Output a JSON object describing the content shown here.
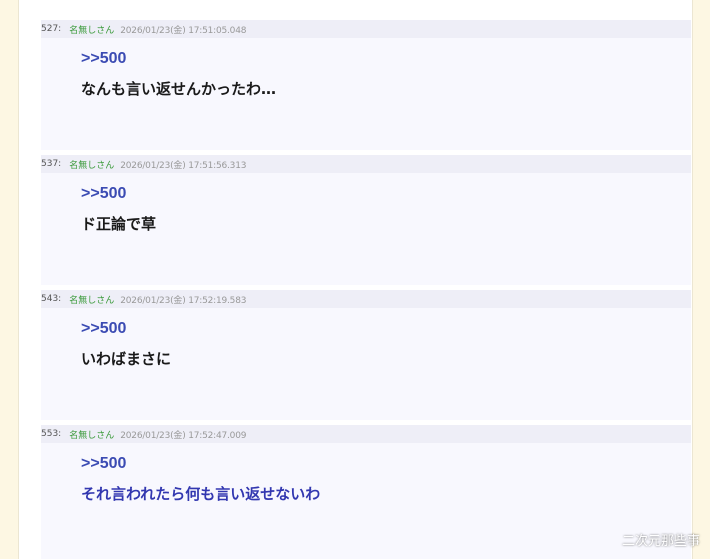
{
  "posts": [
    {
      "num": "527:",
      "name": "名無しさん",
      "date": "2026/01/23(金) 17:51:05.048",
      "anchor": ">>500",
      "message": "なんも言い返せんかったわ…"
    },
    {
      "num": "537:",
      "name": "名無しさん",
      "date": "2026/01/23(金) 17:51:56.313",
      "anchor": ">>500",
      "message": "ド正論で草"
    },
    {
      "num": "543:",
      "name": "名無しさん",
      "date": "2026/01/23(金) 17:52:19.583",
      "anchor": ">>500",
      "message": "いわばまさに"
    },
    {
      "num": "553:",
      "name": "名無しさん",
      "date": "2026/01/23(金) 17:52:47.009",
      "anchor": ">>500",
      "message": "それ言われたら何も言い返せないわ"
    }
  ],
  "watermark": "二次元那些事",
  "colors": {
    "header_bg": "#eeeef7",
    "name": "#3a9a3a",
    "anchor": "#3b4bb3",
    "message_highlight": "#3237b0"
  }
}
